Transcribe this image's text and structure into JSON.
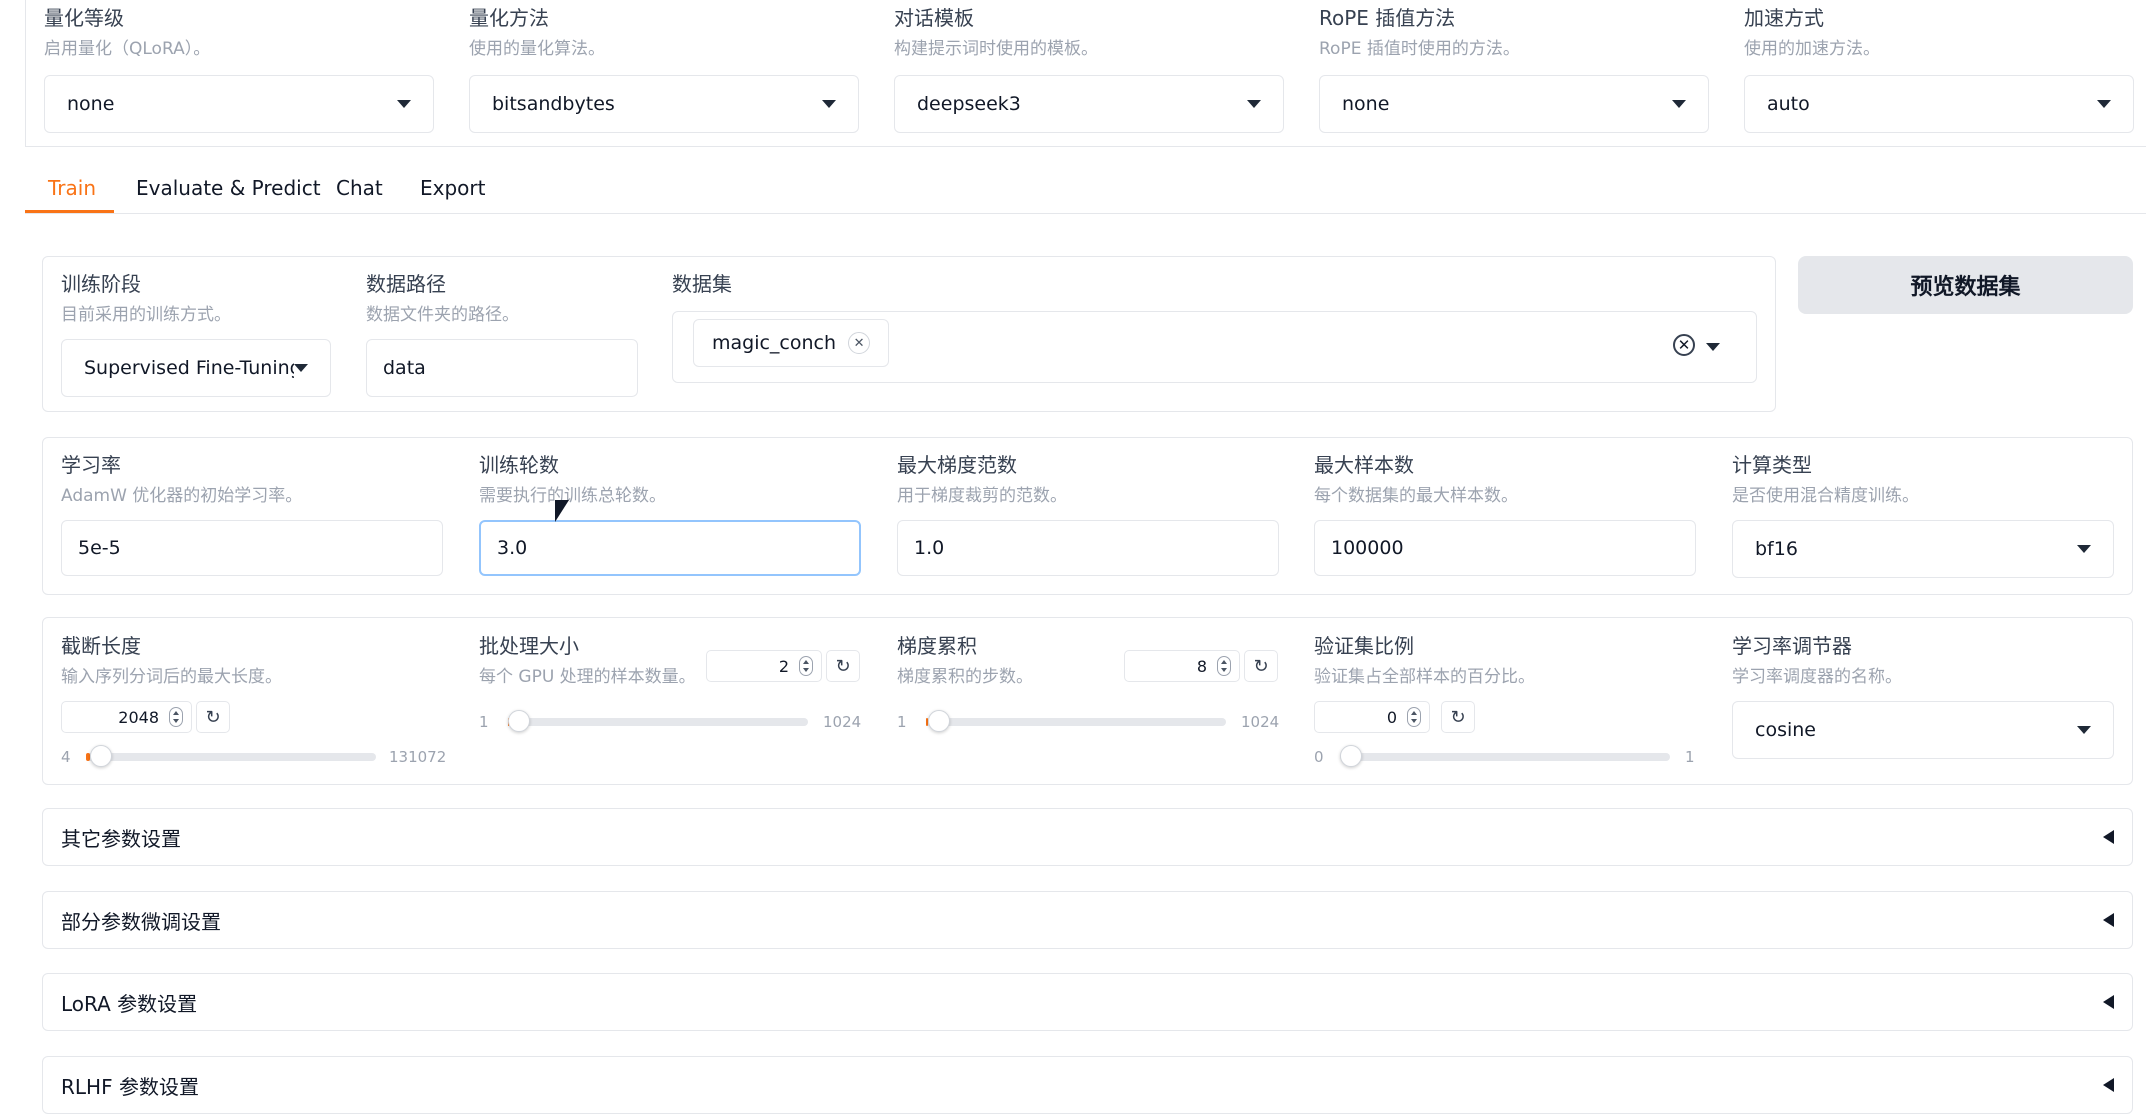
{
  "top": {
    "fields": [
      {
        "label": "量化等级",
        "hint": "启用量化（QLoRA）。",
        "value": "none"
      },
      {
        "label": "量化方法",
        "hint": "使用的量化算法。",
        "value": "bitsandbytes"
      },
      {
        "label": "对话模板",
        "hint": "构建提示词时使用的模板。",
        "value": "deepseek3"
      },
      {
        "label": "RoPE 插值方法",
        "hint": "RoPE 插值时使用的方法。",
        "value": "none"
      },
      {
        "label": "加速方式",
        "hint": "使用的加速方法。",
        "value": "auto"
      }
    ]
  },
  "tabs": [
    {
      "label": "Train"
    },
    {
      "label": "Evaluate & Predict"
    },
    {
      "label": "Chat"
    },
    {
      "label": "Export"
    }
  ],
  "train": {
    "stage": {
      "label": "训练阶段",
      "hint": "目前采用的训练方式。",
      "value": "Supervised Fine-Tuning"
    },
    "data_path": {
      "label": "数据路径",
      "hint": "数据文件夹的路径。",
      "value": "data"
    },
    "dataset": {
      "label": "数据集",
      "chip": "magic_conch"
    },
    "preview_button": "预览数据集",
    "lr": {
      "label": "学习率",
      "hint": "AdamW 优化器的初始学习率。",
      "value": "5e-5"
    },
    "epochs": {
      "label": "训练轮数",
      "hint": "需要执行的训练总轮数。",
      "value": "3.0"
    },
    "max_grad_norm": {
      "label": "最大梯度范数",
      "hint": "用于梯度裁剪的范数。",
      "value": "1.0"
    },
    "max_samples": {
      "label": "最大样本数",
      "hint": "每个数据集的最大样本数。",
      "value": "100000"
    },
    "compute_type": {
      "label": "计算类型",
      "hint": "是否使用混合精度训练。",
      "value": "bf16"
    },
    "cutoff_len": {
      "label": "截断长度",
      "hint": "输入序列分词后的最大长度。",
      "value": "2048",
      "min": "4",
      "max": "131072",
      "fraction": 0.015
    },
    "batch_size": {
      "label": "批处理大小",
      "hint": "每个 GPU 处理的样本数量。",
      "value": "2",
      "min": "1",
      "max": "1024",
      "fraction": 0.001
    },
    "grad_accum": {
      "label": "梯度累积",
      "hint": "梯度累积的步数。",
      "value": "8",
      "min": "1",
      "max": "1024",
      "fraction": 0.007
    },
    "val_size": {
      "label": "验证集比例",
      "hint": "验证集占全部样本的百分比。",
      "value": "0",
      "min": "0",
      "max": "1",
      "fraction": 0.0
    },
    "lr_scheduler": {
      "label": "学习率调节器",
      "hint": "学习率调度器的名称。",
      "value": "cosine"
    }
  },
  "accordions": [
    {
      "label": "其它参数设置"
    },
    {
      "label": "部分参数微调设置"
    },
    {
      "label": "LoRA 参数设置"
    },
    {
      "label": "RLHF 参数设置"
    }
  ]
}
